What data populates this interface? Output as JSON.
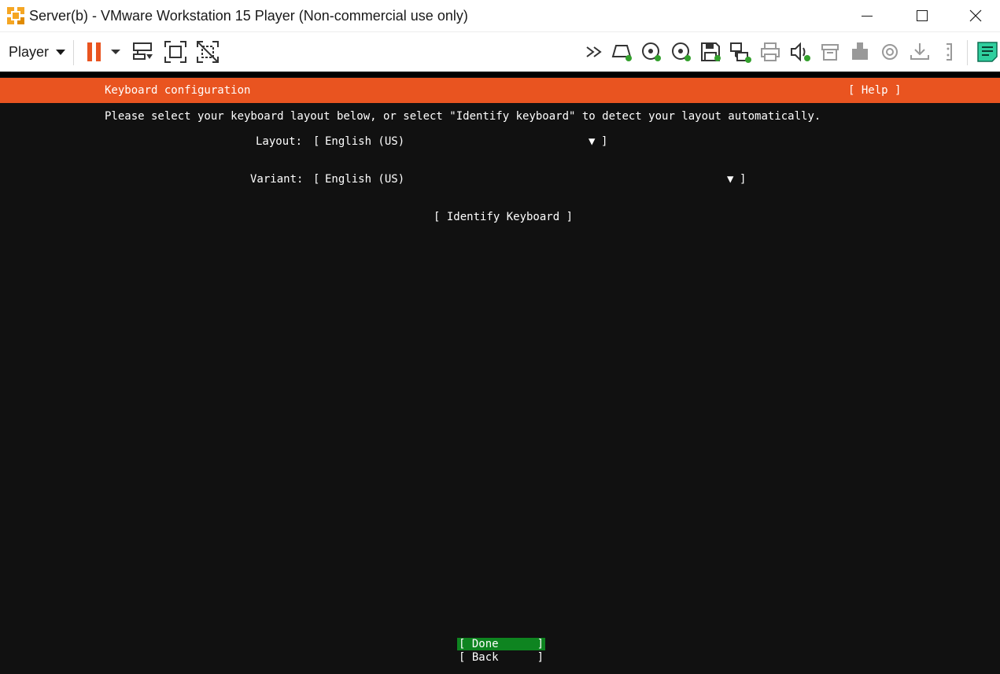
{
  "window": {
    "title": "Server(b) - VMware Workstation 15 Player (Non-commercial use only)"
  },
  "toolbar": {
    "player_menu_label": "Player",
    "icons": [
      "pause-icon",
      "send-ctrl-alt-del-icon",
      "full-screen-icon",
      "unity-icon",
      "more-icon",
      "hard-disk-icon",
      "cd-dvd-1-icon",
      "cd-dvd-2-icon",
      "floppy-icon",
      "network-adapter-icon",
      "printer-icon",
      "sound-card-icon",
      "usb-device-1-icon",
      "usb-device-2-icon",
      "cd-drive-icon",
      "download-icon",
      "serial-port-icon",
      "message-log-icon"
    ],
    "accent_color": "#e95420",
    "status_green": "#33a02c"
  },
  "installer": {
    "header_title": "Keyboard configuration",
    "help_label": "[ Help ]",
    "instruction": "Please select your keyboard layout below, or select \"Identify keyboard\" to detect your layout automatically.",
    "layout_label": "Layout:",
    "layout_value": "English (US)",
    "variant_label": "Variant:",
    "variant_value": "English (US)",
    "bracket_open": "[",
    "bracket_close": "]",
    "dropdown_arrow": "▼",
    "identify_button": "[ Identify Keyboard ]",
    "done_label": "[ Done",
    "back_label": "[ Back",
    "header_color": "#e95420",
    "selected_button_color": "#0e8420"
  }
}
